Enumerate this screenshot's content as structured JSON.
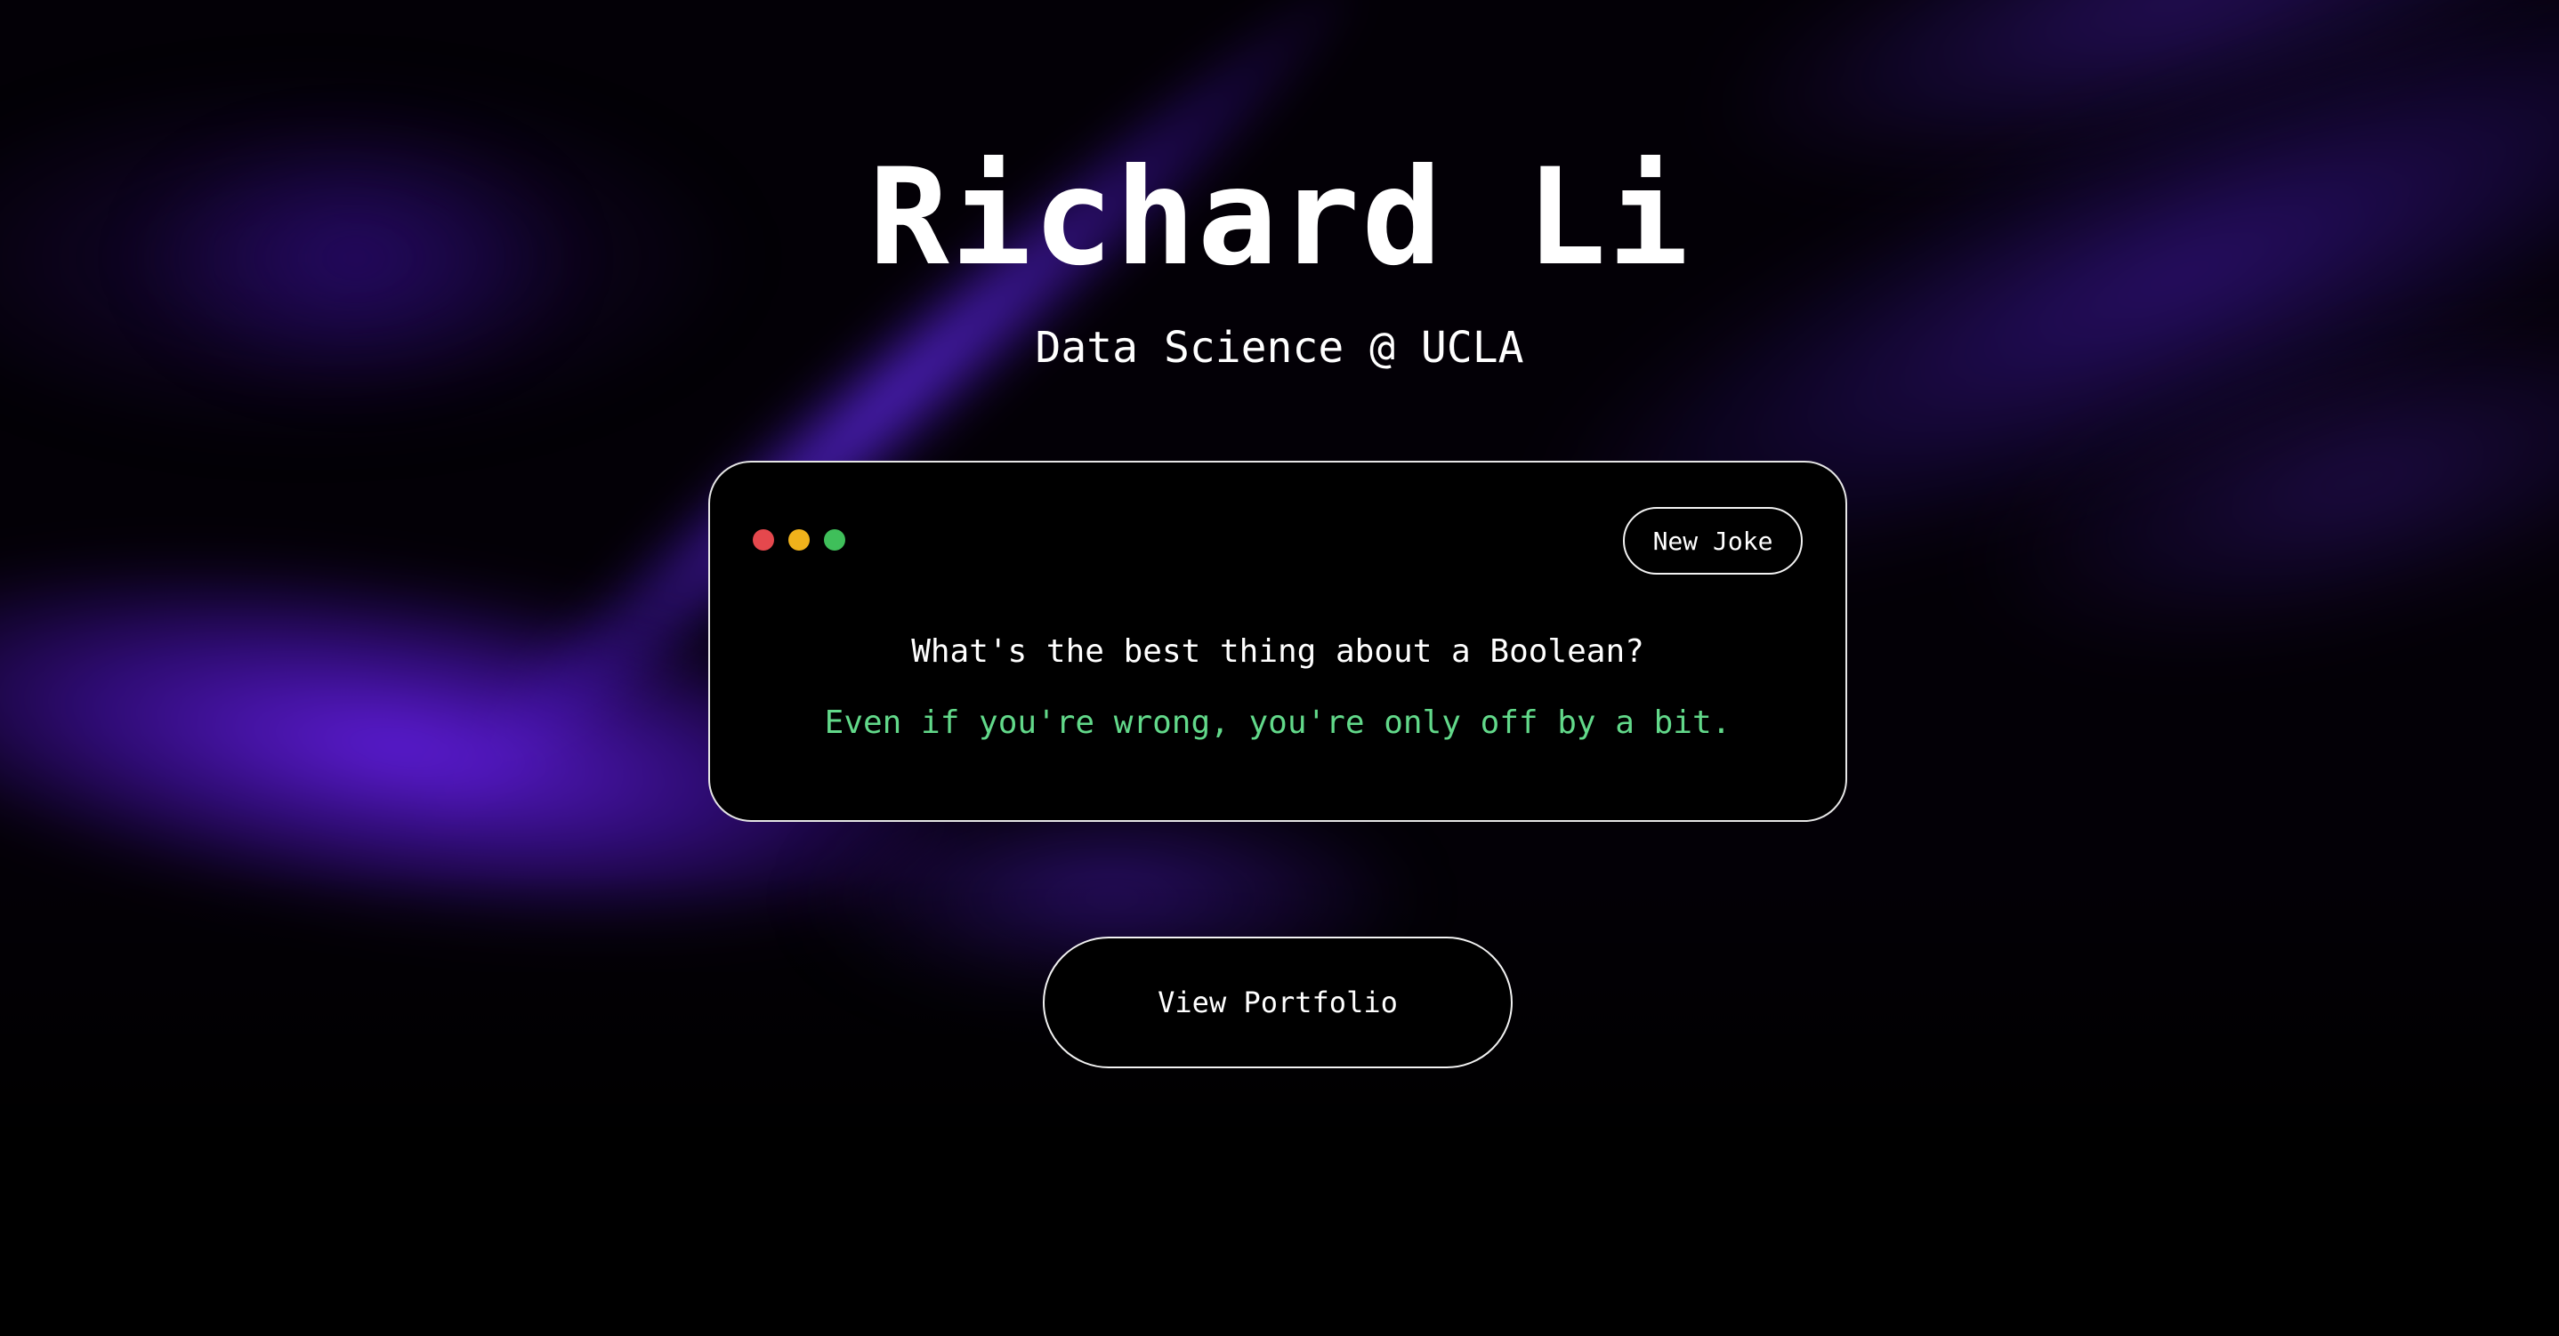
{
  "hero": {
    "name": "Richard Li",
    "tagline": "Data Science @ UCLA"
  },
  "joke_card": {
    "window_controls": [
      {
        "name": "close-dot",
        "color": "#e5484d"
      },
      {
        "name": "minimize-dot",
        "color": "#f0b21b"
      },
      {
        "name": "maximize-dot",
        "color": "#3fbf5a"
      }
    ],
    "new_joke_label": "New Joke",
    "question": "What's the best thing about a Boolean?",
    "answer": "Even if you're wrong, you're only off by a bit.",
    "answer_color": "#62d98a"
  },
  "cta": {
    "portfolio_label": "View Portfolio"
  },
  "theme": {
    "background": "#000000",
    "accent": "#5a1ee0"
  }
}
